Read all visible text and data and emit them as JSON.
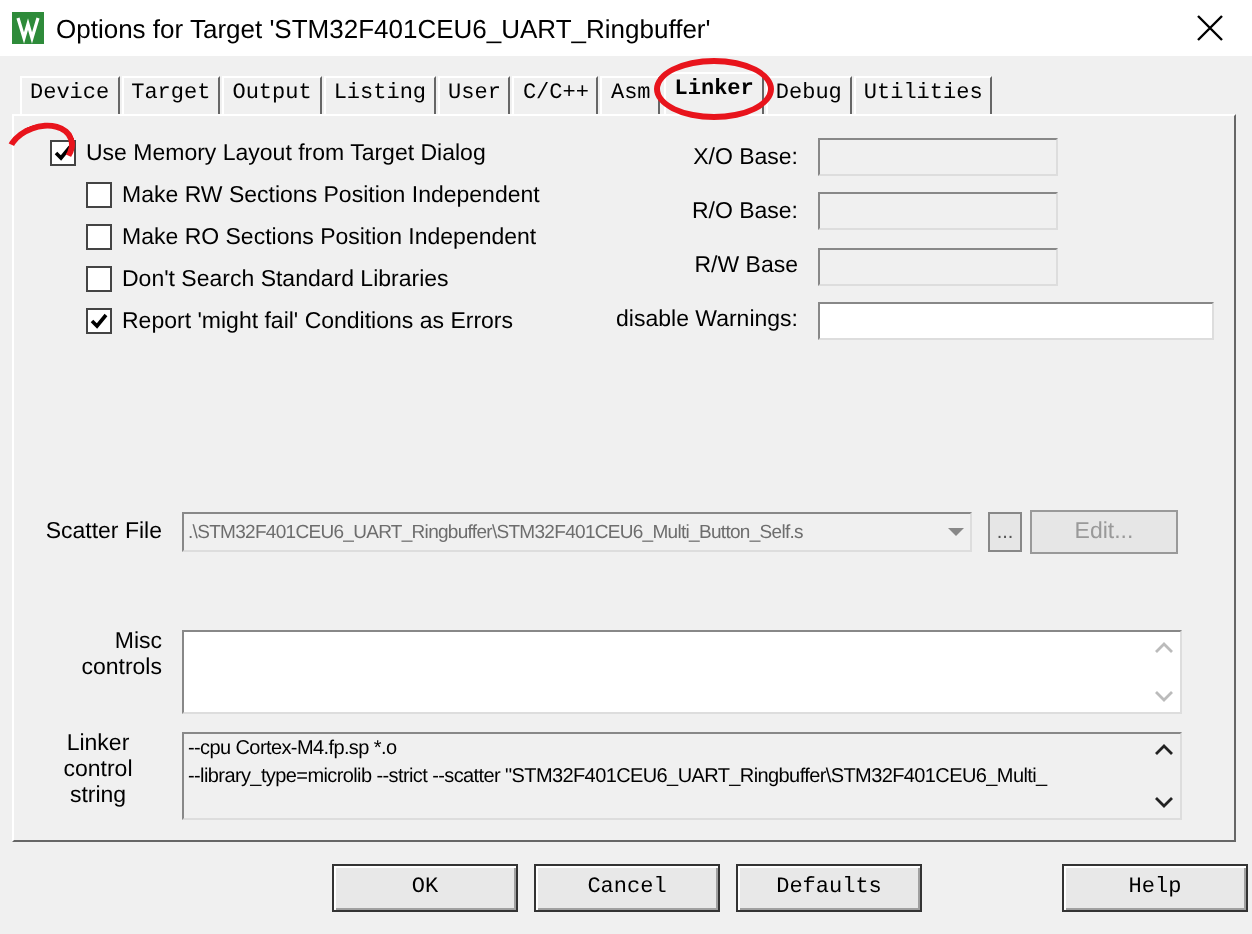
{
  "window": {
    "title": "Options for Target 'STM32F401CEU6_UART_Ringbuffer'"
  },
  "tabs": [
    {
      "label": "Device",
      "selected": false
    },
    {
      "label": "Target",
      "selected": false
    },
    {
      "label": "Output",
      "selected": false
    },
    {
      "label": "Listing",
      "selected": false
    },
    {
      "label": "User",
      "selected": false
    },
    {
      "label": "C/C++",
      "selected": false
    },
    {
      "label": "Asm",
      "selected": false
    },
    {
      "label": "Linker",
      "selected": true
    },
    {
      "label": "Debug",
      "selected": false
    },
    {
      "label": "Utilities",
      "selected": false
    }
  ],
  "options": [
    {
      "label": "Use Memory Layout from Target Dialog",
      "checked": true,
      "children": [
        {
          "label": "Make RW Sections Position Independent",
          "checked": false
        },
        {
          "label": "Make RO Sections Position Independent",
          "checked": false
        },
        {
          "label": "Don't Search Standard Libraries",
          "checked": false
        },
        {
          "label": "Report 'might fail' Conditions as Errors",
          "checked": true
        }
      ]
    }
  ],
  "address_fields": [
    {
      "label": "X/O Base:",
      "disabled": true
    },
    {
      "label": "R/O Base:",
      "disabled": true
    },
    {
      "label": "R/W Base",
      "disabled": true
    },
    {
      "label": "disable Warnings:",
      "disabled": false
    }
  ],
  "scatter_file": {
    "label": "Scatter File",
    "value": ".\\STM32F401CEU6_UART_Ringbuffer\\STM32F401CEU6_Multi_Button_Self.s",
    "disabled": true,
    "browse_button": "...",
    "edit_button": {
      "label": "Edit...",
      "disabled": true
    }
  },
  "misc_controls": {
    "label": "Misc controls"
  },
  "linker_control_string": {
    "label": "Linker control string",
    "lines": [
      "--cpu Cortex-M4.fp.sp *.o",
      "--library_type=microlib --strict --scatter \"STM32F401CEU6_UART_Ringbuffer\\STM32F401CEU6_Multi_"
    ]
  },
  "buttons": [
    "OK",
    "Cancel",
    "Defaults",
    "Help"
  ]
}
